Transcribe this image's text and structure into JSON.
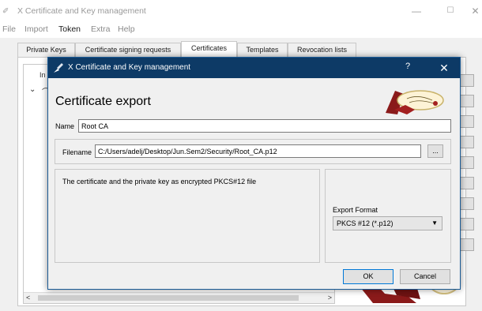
{
  "main_window": {
    "title": "X Certificate and Key management",
    "controls": {
      "minimize": "—",
      "maximize": "☐",
      "close": "✕"
    },
    "menu": [
      "File",
      "Import",
      "Token",
      "Extra",
      "Help"
    ],
    "active_menu": "Token",
    "tabs": [
      "Private Keys",
      "Certificate signing requests",
      "Certificates",
      "Templates",
      "Revocation lists"
    ],
    "selected_tab": "Certificates",
    "tree": {
      "header_partial": "In",
      "expand_glyph": "⌄",
      "item_glyph": "⌒"
    },
    "scroll": {
      "left": "<",
      "right": ">"
    }
  },
  "dialog": {
    "title": "X Certificate and Key management",
    "help": "?",
    "close": "✕",
    "heading": "Certificate export",
    "name": {
      "label": "Name",
      "value": "Root CA"
    },
    "file": {
      "label": "Filename",
      "value": "C:/Users/adelj/Desktop/Jun.Sem2/Security/Root_CA.p12",
      "browse_label": "..."
    },
    "description": "The certificate and the private key as encrypted PKCS#12 file",
    "export_format": {
      "label": "Export Format",
      "selected": "PKCS #12 (*.p12)"
    },
    "buttons": {
      "ok": "OK",
      "cancel": "Cancel"
    }
  },
  "colors": {
    "dialog_titlebar": "#0d3a66",
    "ok_border": "#0078d7",
    "seal_red": "#8a1a1a"
  }
}
